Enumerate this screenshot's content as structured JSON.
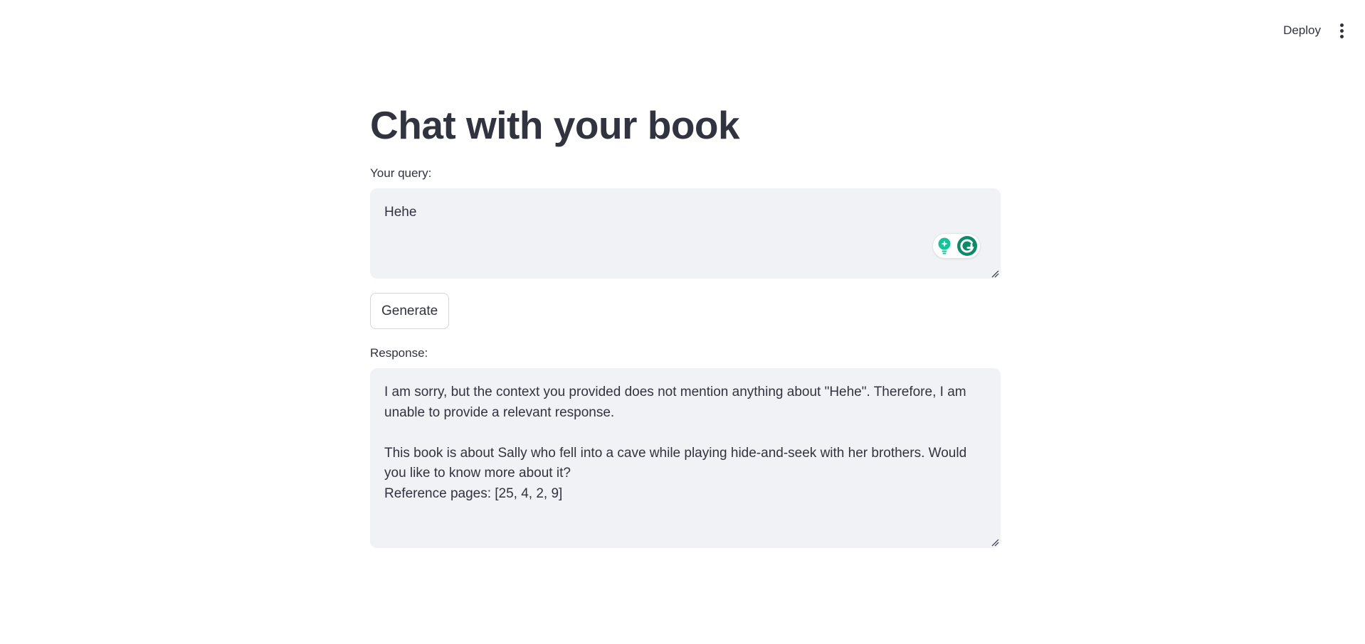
{
  "header": {
    "deploy_label": "Deploy",
    "menu_icon": "more-vertical-icon"
  },
  "main": {
    "title": "Chat with your book",
    "query": {
      "label": "Your query:",
      "value": "Hehe"
    },
    "generate_label": "Generate",
    "response": {
      "label": "Response:",
      "value": "I am sorry, but the context you provided does not mention anything about \"Hehe\". Therefore, I am unable to provide a relevant response.\n\nThis book is about Sally who fell into a cave while playing hide-and-seek with her brothers. Would you like to know more about it?\nReference pages: [25, 4, 2, 9]"
    }
  },
  "colors": {
    "text": "#31333f",
    "textarea_bg": "#f0f2f6",
    "grammarly_green": "#15c39a",
    "grammarly_dark_green": "#0e8a6a"
  },
  "icons": {
    "grammarly_suggestion": "lightbulb-icon",
    "grammarly_logo": "grammarly-g-icon",
    "resize": "resize-handle-icon"
  }
}
